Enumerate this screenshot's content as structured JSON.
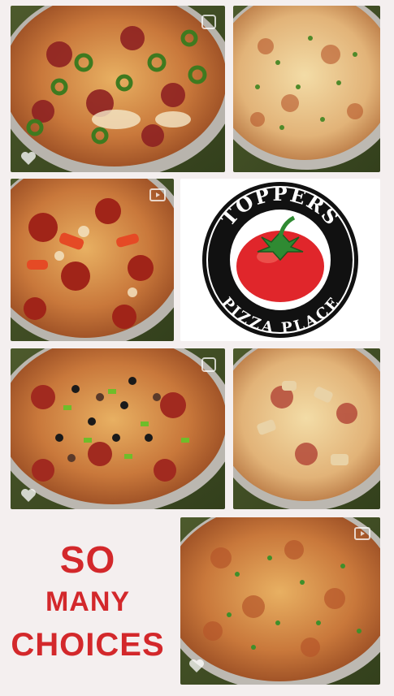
{
  "logo": {
    "top_text": "TOPPERS",
    "bottom_text": "PIZZA PLACE",
    "tomato_color": "#e0262b",
    "ring_color": "#111111"
  },
  "tagline": {
    "line1": "SO",
    "line2": "MANY",
    "line3": "CHOICES",
    "color": "#d3282b"
  },
  "tiles": [
    {
      "name": "jalapeno-pepperoni-pizza",
      "icon": "multi-image-icon"
    },
    {
      "name": "cheese-herb-pizza",
      "icon": "none"
    },
    {
      "name": "pepperoni-tomato-pizza",
      "icon": "play-icon"
    },
    {
      "name": "supreme-pizza",
      "icon": "multi-image-icon"
    },
    {
      "name": "chicken-ham-pizza",
      "icon": "none"
    },
    {
      "name": "herb-pizza",
      "icon": "play-icon"
    }
  ]
}
